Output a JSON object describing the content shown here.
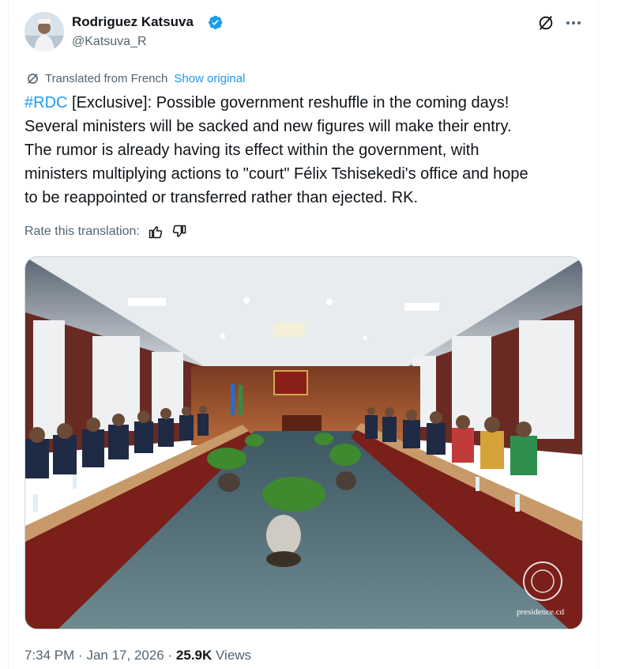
{
  "author": {
    "name": "Rodriguez Katsuva",
    "handle": "@Katsuva_R",
    "verified_color": "#1d9bf0"
  },
  "header_icons": [
    "grok-icon",
    "more-icon"
  ],
  "translation": {
    "notice": "Translated from French",
    "show_original": "Show original",
    "rate_label": "Rate this translation:",
    "icons": [
      "thumbs-up-icon",
      "thumbs-down-icon"
    ]
  },
  "tweet": {
    "hashtag": "#RDC",
    "line1_rest": " [Exclusive]: Possible government reshuffle in the coming days!",
    "line2": "Several ministers will be sacked and new figures will make their entry.",
    "line3": "The rumor is already having its effect within the government, with",
    "line4": "ministers multiplying actions to \"court\" Félix Tshisekedi's office and hope",
    "line5": "to be reappointed or transferred rather than ejected. RK."
  },
  "photo": {
    "watermark": "presidence.cd"
  },
  "meta": {
    "time": "7:34 PM",
    "separator": "·",
    "date": "Jan 17, 2026",
    "views_count": "25.9K",
    "views_label": "Views"
  },
  "colors": {
    "accent": "#1d9bf0",
    "secondary_text": "#536471",
    "primary_text": "#0f1419"
  }
}
